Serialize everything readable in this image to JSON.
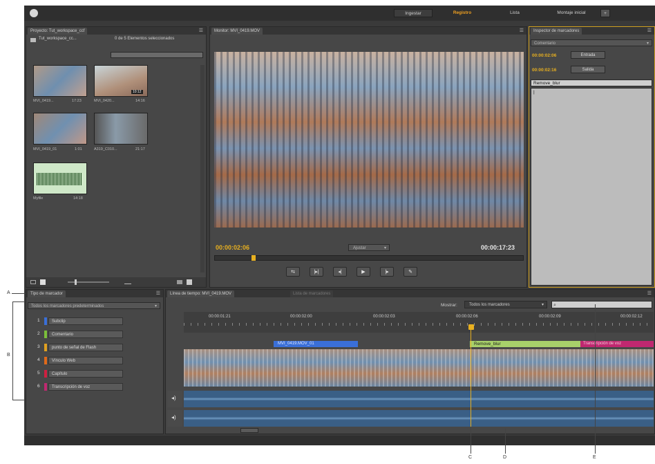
{
  "workspace_tabs": {
    "ingest": "Ingestar",
    "logging": "Registro",
    "list": "Lista",
    "rough_cut": "Montaje inicial",
    "plus": "+"
  },
  "project": {
    "tab": "Proyecto: Tut_workspace_ccf",
    "folder": "Tut_workspace_cc...",
    "selection": "0 de 5 Elementos seleccionados",
    "clips": [
      {
        "name": "MVI_0419...",
        "duration": "17:23"
      },
      {
        "name": "MVI_0420...",
        "duration": "14:16",
        "badge": "10:12"
      },
      {
        "name": "MVI_0419_01",
        "duration": "1:01"
      },
      {
        "name": "A319_C010...",
        "duration": "21:17"
      },
      {
        "name": "Myfile",
        "duration": "14:18"
      }
    ]
  },
  "monitor": {
    "tab": "Monitor: MVI_0419.MOV",
    "current_time": "00:00:02:06",
    "duration": "00:00:17:23",
    "fit": "Ajustar",
    "playhead_fraction": 0.12
  },
  "inspector": {
    "tab": "Inspector de marcadores",
    "type": "Comentario",
    "in_time": "00:00:02:06",
    "in_label": "Entrada",
    "out_time": "00:00:02:16",
    "out_label": "Salida",
    "name": "Remove_blur",
    "comment": "|"
  },
  "marker_type": {
    "tab": "Tipo de marcador",
    "filter": "Todos los marcadores predeterminados",
    "items": [
      {
        "num": "1",
        "label": "Subclip",
        "color": "#3a6fd8"
      },
      {
        "num": "2",
        "label": "Comentario",
        "color": "#7bbf3a"
      },
      {
        "num": "3",
        "label": "punto de señal de Flash",
        "color": "#e0a020"
      },
      {
        "num": "4",
        "label": "Vínculo Web",
        "color": "#e06a1a"
      },
      {
        "num": "5",
        "label": "Capítulo",
        "color": "#d02040"
      },
      {
        "num": "6",
        "label": "Transcripción de voz",
        "color": "#c02870"
      }
    ]
  },
  "timeline": {
    "tab": "Línea de tiempo: MVI_0419.MOV",
    "tab2": "Lista de marcadores",
    "show_label": "Mostrar:",
    "show_value": "Todos los marcadores",
    "ticks": [
      "00:00:01:21",
      "00:00:02:00",
      "00:00:02:03",
      "00:00:02:06",
      "00:00:02:09",
      "00:00:02:12"
    ],
    "subclip_label": "MVI_0419.MOV_01",
    "comment_marker": "Remove_blur",
    "speech_marker": "Transcripción de voz"
  },
  "callouts": {
    "a": "A",
    "b": "B",
    "c": "C",
    "d": "D",
    "e": "E"
  },
  "colors": {
    "accent": "#e8b020",
    "subclip": "#3a6fd8",
    "comment": "#a8d06a",
    "speech": "#c02870",
    "audio": "#3a5f86"
  }
}
